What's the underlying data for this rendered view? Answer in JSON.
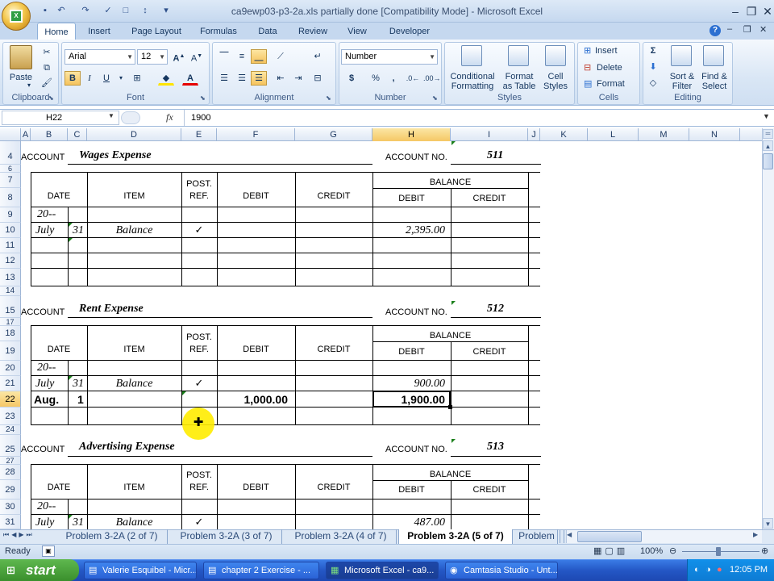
{
  "window": {
    "title": "ca9ewp03-p3-2a.xls partially done  [Compatibility Mode] - Microsoft Excel"
  },
  "tabs": [
    "Home",
    "Insert",
    "Page Layout",
    "Formulas",
    "Data",
    "Review",
    "View",
    "Developer"
  ],
  "ribbon": {
    "clipboard": {
      "label": "Clipboard",
      "paste": "Paste"
    },
    "font": {
      "label": "Font",
      "name": "Arial",
      "size": "12",
      "bold": "B",
      "italic": "I",
      "underline": "U"
    },
    "alignment": {
      "label": "Alignment"
    },
    "number": {
      "label": "Number",
      "format": "Number",
      "currency": "$",
      "percent": "%",
      "comma": ","
    },
    "styles": {
      "label": "Styles",
      "conditional": "Conditional",
      "conditional2": "Formatting",
      "format_table": "Format",
      "format_table2": "as Table",
      "cell_styles": "Cell",
      "cell_styles2": "Styles"
    },
    "cells": {
      "label": "Cells",
      "insert": "Insert",
      "delete": "Delete",
      "format": "Format"
    },
    "editing": {
      "label": "Editing",
      "sort": "Sort &",
      "sort2": "Filter",
      "find": "Find &",
      "find2": "Select"
    }
  },
  "formula_bar": {
    "name_box": "H22",
    "fx": "fx",
    "value": "1900"
  },
  "columns": [
    "A",
    "B",
    "C",
    "D",
    "E",
    "F",
    "G",
    "H",
    "I",
    "J",
    "K",
    "L",
    "M",
    "N"
  ],
  "rows": [
    "4",
    "6",
    "7",
    "8",
    "9",
    "10",
    "11",
    "12",
    "13",
    "14",
    "15",
    "17",
    "18",
    "19",
    "20",
    "21",
    "22",
    "23",
    "24",
    "25",
    "27",
    "28",
    "29",
    "30",
    "31"
  ],
  "labels": {
    "account": "ACCOUNT",
    "account_no": "ACCOUNT NO.",
    "date": "DATE",
    "item": "ITEM",
    "post": "POST.",
    "ref": "REF.",
    "debit": "DEBIT",
    "credit": "CREDIT",
    "balance": "BALANCE"
  },
  "ledgers": [
    {
      "name": "Wages Expense",
      "number": "511",
      "year": "20--",
      "month": "July",
      "day": "31",
      "item": "Balance",
      "check": "✓",
      "balance": "2,395.00"
    },
    {
      "name": "Rent Expense",
      "number": "512",
      "year": "20--",
      "month": "July",
      "day": "31",
      "item": "Balance",
      "check": "✓",
      "balance": "900.00",
      "entry": {
        "month": "Aug.",
        "day": "1",
        "debit": "1,000.00",
        "balance": "1,900.00"
      }
    },
    {
      "name": "Advertising Expense",
      "number": "513",
      "year": "20--",
      "month": "July",
      "day": "31",
      "item": "Balance",
      "check": "✓",
      "balance": "487.00"
    }
  ],
  "sheet_tabs": [
    "Problem 3-2A (2 of 7)",
    "Problem 3-2A (3 of 7)",
    "Problem 3-2A (4 of 7)",
    "Problem 3-2A (5 of 7)",
    "Problem"
  ],
  "status": {
    "ready": "Ready",
    "zoom": "100%"
  },
  "taskbar": {
    "start": "start",
    "items": [
      "Valerie Esquibel - Micr...",
      "chapter 2 Exercise - ...",
      "Microsoft Excel - ca9...",
      "Camtasia Studio - Unt..."
    ],
    "clock": "12:05 PM"
  }
}
